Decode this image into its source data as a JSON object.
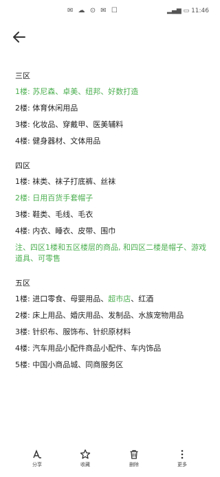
{
  "status_bar": {
    "time": "11:46",
    "icons": [
      "notification-icon",
      "wifi-icon",
      "signal-icon",
      "battery-icon"
    ]
  },
  "sections": [
    {
      "title": "三区",
      "lines": [
        {
          "label": "1楼",
          "sep": ": ",
          "text": "苏尼森、卓美、纽邦、好数打造",
          "color": "green",
          "full_green": true
        },
        {
          "label": "2楼",
          "sep": ": ",
          "text": "体育休闲用品"
        },
        {
          "label": "3楼",
          "sep": ": ",
          "text": "化妆品、穿戴甲、医美辅料"
        },
        {
          "label": "4楼",
          "sep": ": ",
          "text": "健身器材、文体用品"
        }
      ]
    },
    {
      "title": "四区",
      "lines": [
        {
          "label": "1楼",
          "sep": ": ",
          "text": "袜类、袜子打底裤、丝袜"
        },
        {
          "label": "2楼",
          "sep": ": ",
          "text": "日用百货手套帽子",
          "full_green": true
        },
        {
          "label": "3楼",
          "sep": ": ",
          "text": "鞋类、毛线、毛衣"
        },
        {
          "label": "4楼",
          "sep": ": ",
          "text": "内衣、睡衣、皮带、围巾"
        },
        {
          "label": "",
          "sep": "",
          "text": "注、四区1楼和五区楼层的商品, 和四区二楼是帽子、游戏道具、可零售",
          "full_green": true,
          "wrap": true
        }
      ]
    },
    {
      "title": "五区",
      "lines": [
        {
          "label": "1楼",
          "sep": ": ",
          "text_before": "进口零食、母婴用品、",
          "text_green": "超市店",
          "text_after": "、红酒",
          "mixed": true
        },
        {
          "label": "2楼",
          "sep": ": ",
          "text": "床上用品、婚庆用品、发制品、水族宠物用品",
          "wrap": true
        },
        {
          "label": "3楼",
          "sep": ": ",
          "text": "针织布、服饰布、针织原材料"
        },
        {
          "label": "4楼",
          "sep": ": ",
          "text": "汽车用品小配件商品小配件、车内饰品"
        },
        {
          "label": "5楼",
          "sep": ": ",
          "text": "中国小商品城、同商服务区"
        }
      ]
    }
  ],
  "bottom_bar": [
    {
      "name": "share",
      "label": "分享",
      "icon": "share-icon"
    },
    {
      "name": "favorite",
      "label": "收藏",
      "icon": "star-icon"
    },
    {
      "name": "delete",
      "label": "删除",
      "icon": "trash-icon"
    },
    {
      "name": "more",
      "label": "更多",
      "icon": "more-icon"
    }
  ],
  "colors": {
    "accent_green": "#4caf50",
    "text": "#222222"
  }
}
